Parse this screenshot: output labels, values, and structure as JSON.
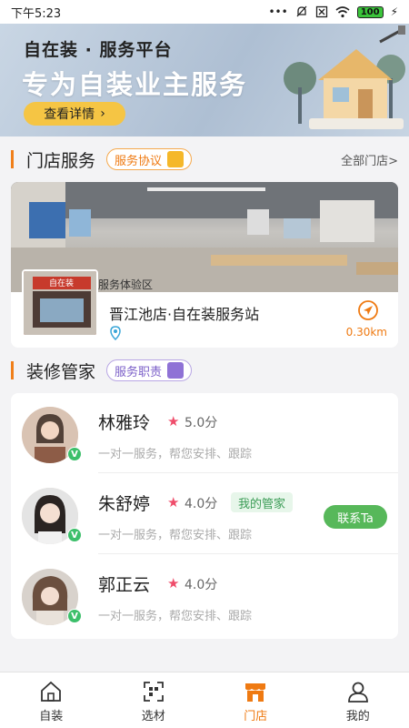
{
  "status_bar": {
    "time": "下午5:23",
    "icons": [
      "dots-icon",
      "mute-icon",
      "sim-icon",
      "wifi-icon",
      "battery-icon",
      "charging-icon"
    ],
    "battery": "100"
  },
  "banner": {
    "subtitle": "自在装 · 服务平台",
    "headline": "专为自装业主服务",
    "detail_button": "查看详情"
  },
  "store_section": {
    "title": "门店服务",
    "agreement_pill": "服务协议",
    "all_stores_link": "全部门店>",
    "store": {
      "photo_sign": "服务体验区",
      "thumb_sign": "自在装",
      "name": "晋江池店·自在装服务站",
      "distance": "0.30km"
    }
  },
  "steward_section": {
    "title": "装修管家",
    "duty_pill": "服务职责",
    "stewards": [
      {
        "name": "林雅玲",
        "score": "5.0分",
        "desc": "一对一服务，帮您安排、跟踪",
        "tag": "",
        "contact": "",
        "verified": "V"
      },
      {
        "name": "朱舒婷",
        "score": "4.0分",
        "desc": "一对一服务，帮您安排、跟踪",
        "tag": "我的管家",
        "contact": "联系Ta",
        "verified": "V"
      },
      {
        "name": "郭正云",
        "score": "4.0分",
        "desc": "一对一服务，帮您安排、跟踪",
        "tag": "",
        "contact": "",
        "verified": "V"
      }
    ]
  },
  "tab_bar": {
    "tabs": [
      {
        "label": "自装",
        "icon": "home-icon"
      },
      {
        "label": "选材",
        "icon": "scan-icon"
      },
      {
        "label": "门店",
        "icon": "store-icon",
        "active": true
      },
      {
        "label": "我的",
        "icon": "user-icon"
      }
    ]
  },
  "colors": {
    "accent": "#ef7a12",
    "section_bar": "#f07f1a",
    "contact_button": "#57b85a",
    "star": "#ef4d6b",
    "tag_bg": "#e7f6ea",
    "tag_text": "#3b9c56"
  }
}
